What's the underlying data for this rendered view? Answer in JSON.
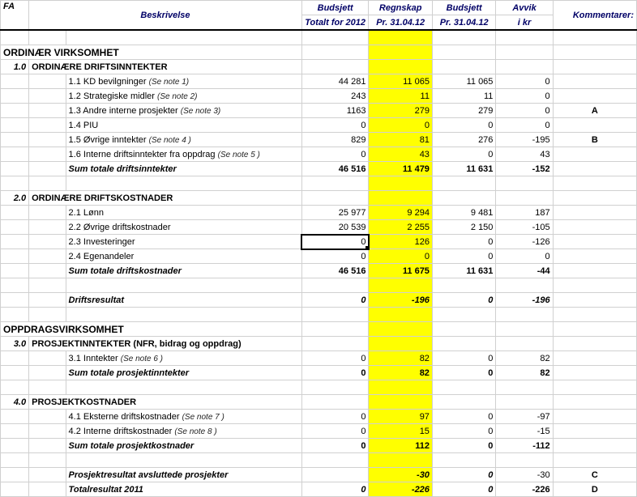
{
  "headers": {
    "fa": "FA",
    "beskrivelse": "Beskrivelse",
    "budsjett_tot_1": "Budsjett",
    "budsjett_tot_2": "Totalt for 2012",
    "regnskap_1": "Regnskap",
    "regnskap_2": "Pr. 31.04.12",
    "budsjett_pr_1": "Budsjett",
    "budsjett_pr_2": "Pr. 31.04.12",
    "avvik_1": "Avvik",
    "avvik_2": "i kr",
    "kommentarer": "Kommentarer:"
  },
  "s1_title": "ORDINÆR VIRKSOMHET",
  "g1": {
    "fa": "1.0",
    "title": "ORDINÆRE DRIFTSINNTEKTER"
  },
  "r11": {
    "desc": "1.1 KD bevilgninger",
    "note": "(Se note 1)",
    "c1": "44 281",
    "c2": "11 065",
    "c3": "11 065",
    "c4": "0",
    "kom": ""
  },
  "r12": {
    "desc": "1.2 Strategiske midler",
    "note": "(Se note 2)",
    "c1": "243",
    "c2": "11",
    "c3": "11",
    "c4": "0",
    "kom": ""
  },
  "r13": {
    "desc": "1.3 Andre interne prosjekter",
    "note": "(Se note 3)",
    "c1": "1163",
    "c2": "279",
    "c3": "279",
    "c4": "0",
    "kom": "A"
  },
  "r14": {
    "desc": "1.4 PIU",
    "c1": "0",
    "c2": "0",
    "c3": "0",
    "c4": "0",
    "kom": ""
  },
  "r15": {
    "desc": "1.5 Øvrige inntekter",
    "note": "(Se note 4 )",
    "c1": "829",
    "c2": "81",
    "c3": "276",
    "c4": "-195",
    "kom": "B"
  },
  "r16": {
    "desc": "1.6 Interne driftsinntekter fra oppdrag",
    "note": "(Se note 5 )",
    "c1": "0",
    "c2": "43",
    "c3": "0",
    "c4": "43",
    "kom": ""
  },
  "sum1": {
    "desc": "Sum totale driftsinntekter",
    "c1": "46 516",
    "c2": "11 479",
    "c3": "11 631",
    "c4": "-152"
  },
  "g2": {
    "fa": "2.0",
    "title": "ORDINÆRE DRIFTSKOSTNADER"
  },
  "r21": {
    "desc": "2.1 Lønn",
    "c1": "25 977",
    "c2": "9 294",
    "c3": "9 481",
    "c4": "187"
  },
  "r22": {
    "desc": "2.2 Øvrige driftskostnader",
    "c1": "20 539",
    "c2": "2 255",
    "c3": "2 150",
    "c4": "-105"
  },
  "r23": {
    "desc": "2.3 Investeringer",
    "c1": "0",
    "c2": "126",
    "c3": "0",
    "c4": "-126"
  },
  "r24": {
    "desc": "2.4 Egenandeler",
    "c1": "0",
    "c2": "0",
    "c3": "0",
    "c4": "0"
  },
  "sum2": {
    "desc": "Sum totale driftskostnader",
    "c1": "46 516",
    "c2": "11 675",
    "c3": "11 631",
    "c4": "-44"
  },
  "drift": {
    "desc": "Driftsresultat",
    "c1": "0",
    "c2": "-196",
    "c3": "0",
    "c4": "-196"
  },
  "s2_title": "OPPDRAGSVIRKSOMHET",
  "g3": {
    "fa": "3.0",
    "title": "PROSJEKTINNTEKTER (NFR, bidrag og oppdrag)"
  },
  "r31": {
    "desc": "3.1 Inntekter",
    "note": "(Se note 6 )",
    "c1": "0",
    "c2": "82",
    "c3": "0",
    "c4": "82"
  },
  "sum3": {
    "desc": "Sum totale prosjektinntekter",
    "c1": "0",
    "c2": "82",
    "c3": "0",
    "c4": "82"
  },
  "g4": {
    "fa": "4.0",
    "title": "PROSJEKTKOSTNADER"
  },
  "r41": {
    "desc": "4.1 Eksterne driftskostnader",
    "note": "(Se note 7 )",
    "c1": "0",
    "c2": "97",
    "c3": "0",
    "c4": "-97"
  },
  "r42": {
    "desc": "4.2 Interne driftskostnader",
    "note": "(Se note  8 )",
    "c1": "0",
    "c2": "15",
    "c3": "0",
    "c4": "-15"
  },
  "sum4": {
    "desc": "Sum totale prosjektkostnader",
    "c1": "0",
    "c2": "112",
    "c3": "0",
    "c4": "-112"
  },
  "pres": {
    "desc": "Prosjektresultat avsluttede prosjekter",
    "c1": "",
    "c2": "-30",
    "c3": "0",
    "c4": "-30",
    "kom": "C"
  },
  "tot": {
    "desc": "Totalresultat 2011",
    "c1": "0",
    "c2": "-226",
    "c3": "0",
    "c4": "-226",
    "kom": "D"
  },
  "chart_data": {
    "type": "table",
    "title": "Budsjett / Regnskap / Avvik",
    "columns": [
      "Beskrivelse",
      "Budsjett Totalt for 2012",
      "Regnskap Pr. 31.04.12",
      "Budsjett Pr. 31.04.12",
      "Avvik i kr",
      "Kommentarer"
    ],
    "rows": [
      [
        "1.1 KD bevilgninger",
        44281,
        11065,
        11065,
        0,
        ""
      ],
      [
        "1.2 Strategiske midler",
        243,
        11,
        11,
        0,
        ""
      ],
      [
        "1.3 Andre interne prosjekter",
        1163,
        279,
        279,
        0,
        "A"
      ],
      [
        "1.4 PIU",
        0,
        0,
        0,
        0,
        ""
      ],
      [
        "1.5 Øvrige inntekter",
        829,
        81,
        276,
        -195,
        "B"
      ],
      [
        "1.6 Interne driftsinntekter fra oppdrag",
        0,
        43,
        0,
        43,
        ""
      ],
      [
        "Sum totale driftsinntekter",
        46516,
        11479,
        11631,
        -152,
        ""
      ],
      [
        "2.1 Lønn",
        25977,
        9294,
        9481,
        187,
        ""
      ],
      [
        "2.2 Øvrige driftskostnader",
        20539,
        2255,
        2150,
        -105,
        ""
      ],
      [
        "2.3 Investeringer",
        0,
        126,
        0,
        -126,
        ""
      ],
      [
        "2.4 Egenandeler",
        0,
        0,
        0,
        0,
        ""
      ],
      [
        "Sum totale driftskostnader",
        46516,
        11675,
        11631,
        -44,
        ""
      ],
      [
        "Driftsresultat",
        0,
        -196,
        0,
        -196,
        ""
      ],
      [
        "3.1 Inntekter",
        0,
        82,
        0,
        82,
        ""
      ],
      [
        "Sum totale prosjektinntekter",
        0,
        82,
        0,
        82,
        ""
      ],
      [
        "4.1 Eksterne driftskostnader",
        0,
        97,
        0,
        -97,
        ""
      ],
      [
        "4.2 Interne driftskostnader",
        0,
        15,
        0,
        -15,
        ""
      ],
      [
        "Sum totale prosjektkostnader",
        0,
        112,
        0,
        -112,
        ""
      ],
      [
        "Prosjektresultat avsluttede prosjekter",
        null,
        -30,
        0,
        -30,
        "C"
      ],
      [
        "Totalresultat 2011",
        0,
        -226,
        0,
        -226,
        "D"
      ]
    ]
  }
}
